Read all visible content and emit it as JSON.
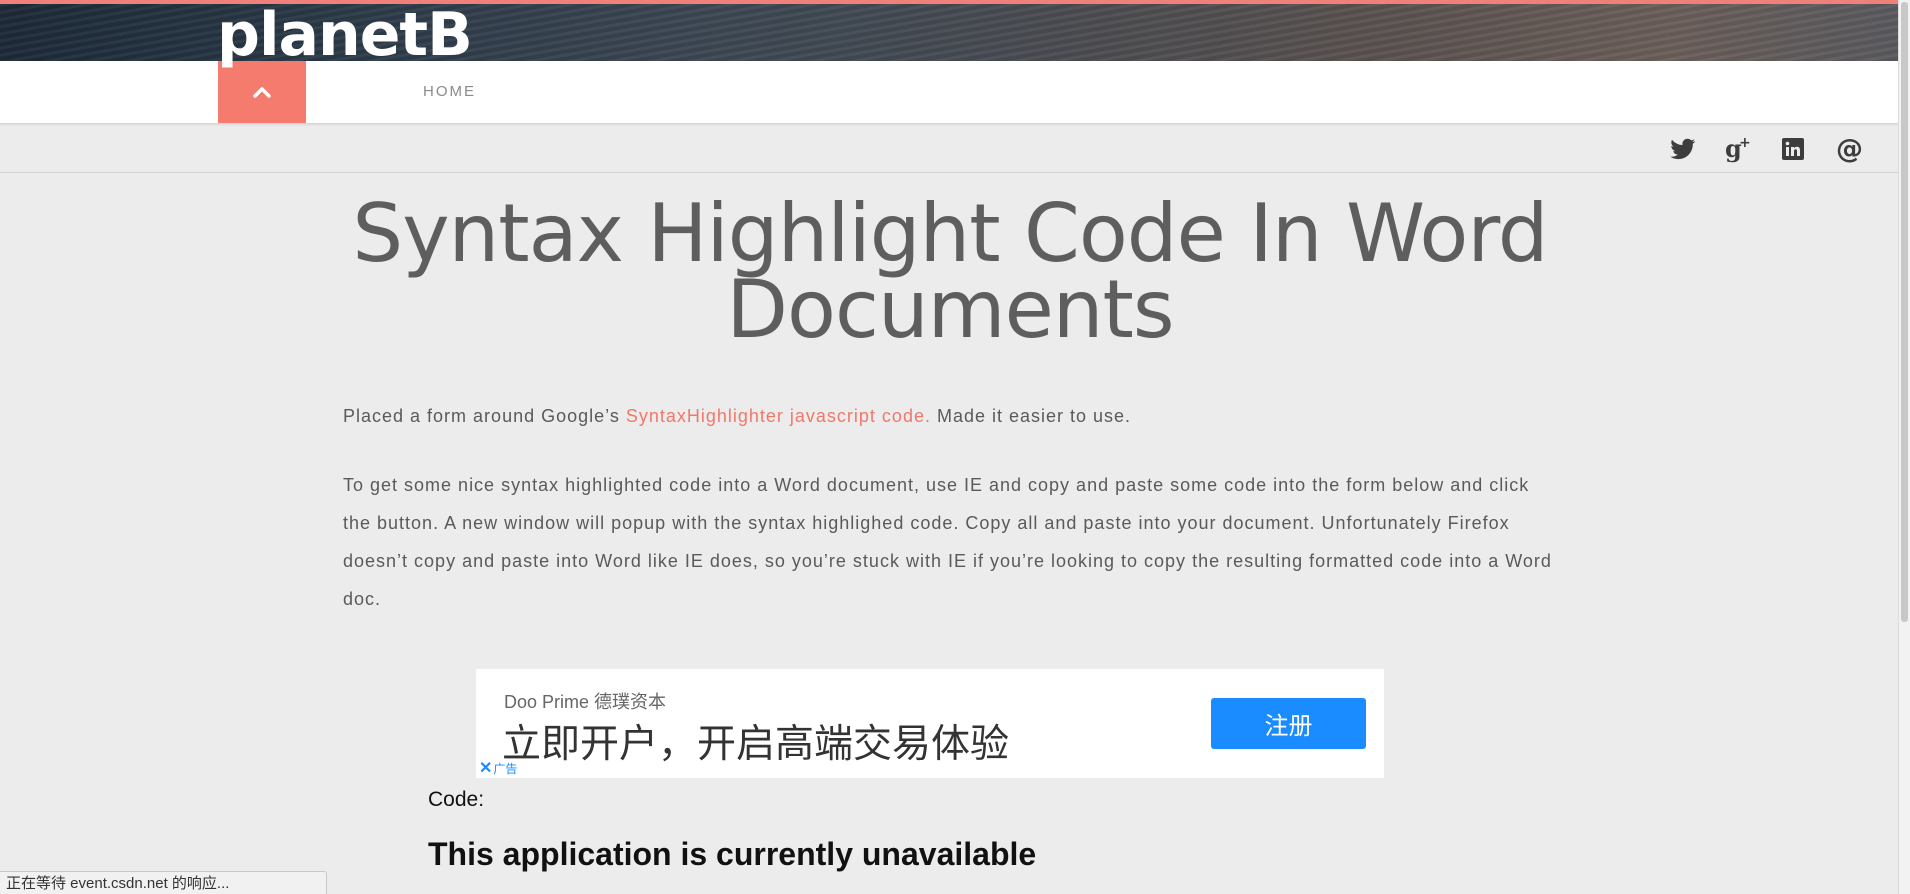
{
  "site": {
    "title": "planetB",
    "accent_color": "#f0817a"
  },
  "nav": {
    "toggle_icon": "chevron-up-icon",
    "home_label": "HOME"
  },
  "social": {
    "icons": [
      "twitter-icon",
      "google-plus-icon",
      "linkedin-icon",
      "email-at-icon"
    ]
  },
  "post": {
    "title": "Syntax Highlight Code In Word Documents",
    "para1_before": "Placed a form around Google’s ",
    "para1_link": "SyntaxHighlighter javascript code.",
    "para1_after": " Made it easier to use.",
    "para2": "To get some nice syntax highlighted code into a Word document, use IE and copy and paste some code into the form below and click the button. A new window will popup with the syntax highlighed code. Copy all and paste into your document. Unfortunately Firefox doesn’t copy and paste into Word like IE does, so you’re stuck with IE if you’re looking to copy the resulting formatted code into a Word doc.",
    "link_color": "#f0786b"
  },
  "ad": {
    "brand": "Doo Prime 德璞资本",
    "headline": "立即开户，开启高端交易体验",
    "cta_label": "注册",
    "badge_label": "广告",
    "cta_color": "#1a8cff"
  },
  "code_section": {
    "label": "Code:",
    "unavailable_message": "This application is currently unavailable"
  },
  "browser": {
    "status_text": "正在等待 event.csdn.net 的响应..."
  }
}
